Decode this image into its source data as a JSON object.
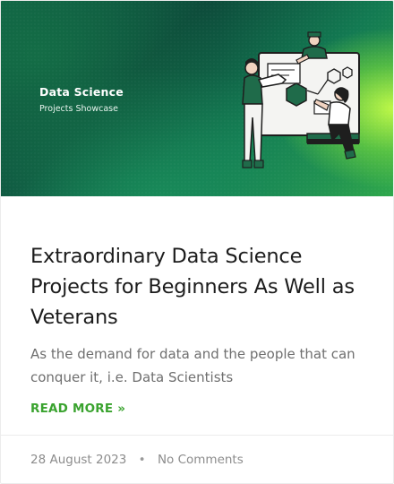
{
  "banner": {
    "title": "Data Science",
    "subtitle": "Projects Showcase"
  },
  "post": {
    "title": "Extraordinary Data Science Projects for Beginners As Well as Veterans",
    "excerpt": "As the demand for data and the people that can conquer it, i.e. Data Scientists",
    "read_more": "READ MORE »"
  },
  "meta": {
    "date": "28 August 2023",
    "separator": "•",
    "comments": "No Comments"
  },
  "colors": {
    "accent": "#3aa32f",
    "banner_dark": "#0d4a3a",
    "banner_light": "#c8ff46",
    "title_text": "#1c1c1c",
    "body_text": "#6f6f6f",
    "meta_text": "#8c8c8c"
  }
}
